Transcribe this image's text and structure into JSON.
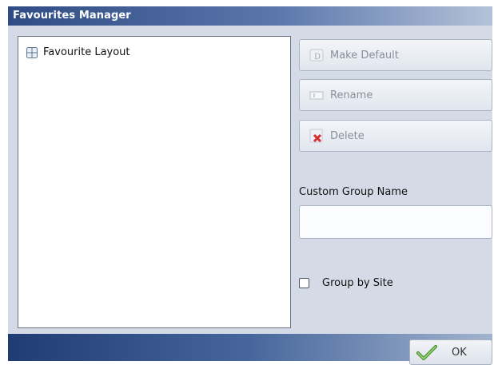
{
  "window": {
    "title": "Favourites Manager"
  },
  "favourites_list": {
    "items": [
      {
        "label": "Favourite Layout",
        "icon": "layout-grid-icon"
      }
    ]
  },
  "actions": {
    "make_default": {
      "label": "Make Default",
      "icon": "make-default-icon",
      "enabled": false
    },
    "rename": {
      "label": "Rename",
      "icon": "rename-icon",
      "enabled": false
    },
    "delete": {
      "label": "Delete",
      "icon": "delete-icon",
      "enabled": false
    }
  },
  "custom_group": {
    "label": "Custom Group Name",
    "value": "",
    "placeholder": ""
  },
  "group_by_site": {
    "label": "Group by Site",
    "checked": false
  },
  "footer": {
    "ok_label": "OK",
    "ok_icon": "checkmark-icon"
  },
  "colors": {
    "titlebar_dark": "#2f4c84",
    "panel_background": "#d4dbe6",
    "disabled_text": "#8a8f98",
    "checkmark_green": "#4a9a2a",
    "delete_red": "#d62d2d"
  }
}
